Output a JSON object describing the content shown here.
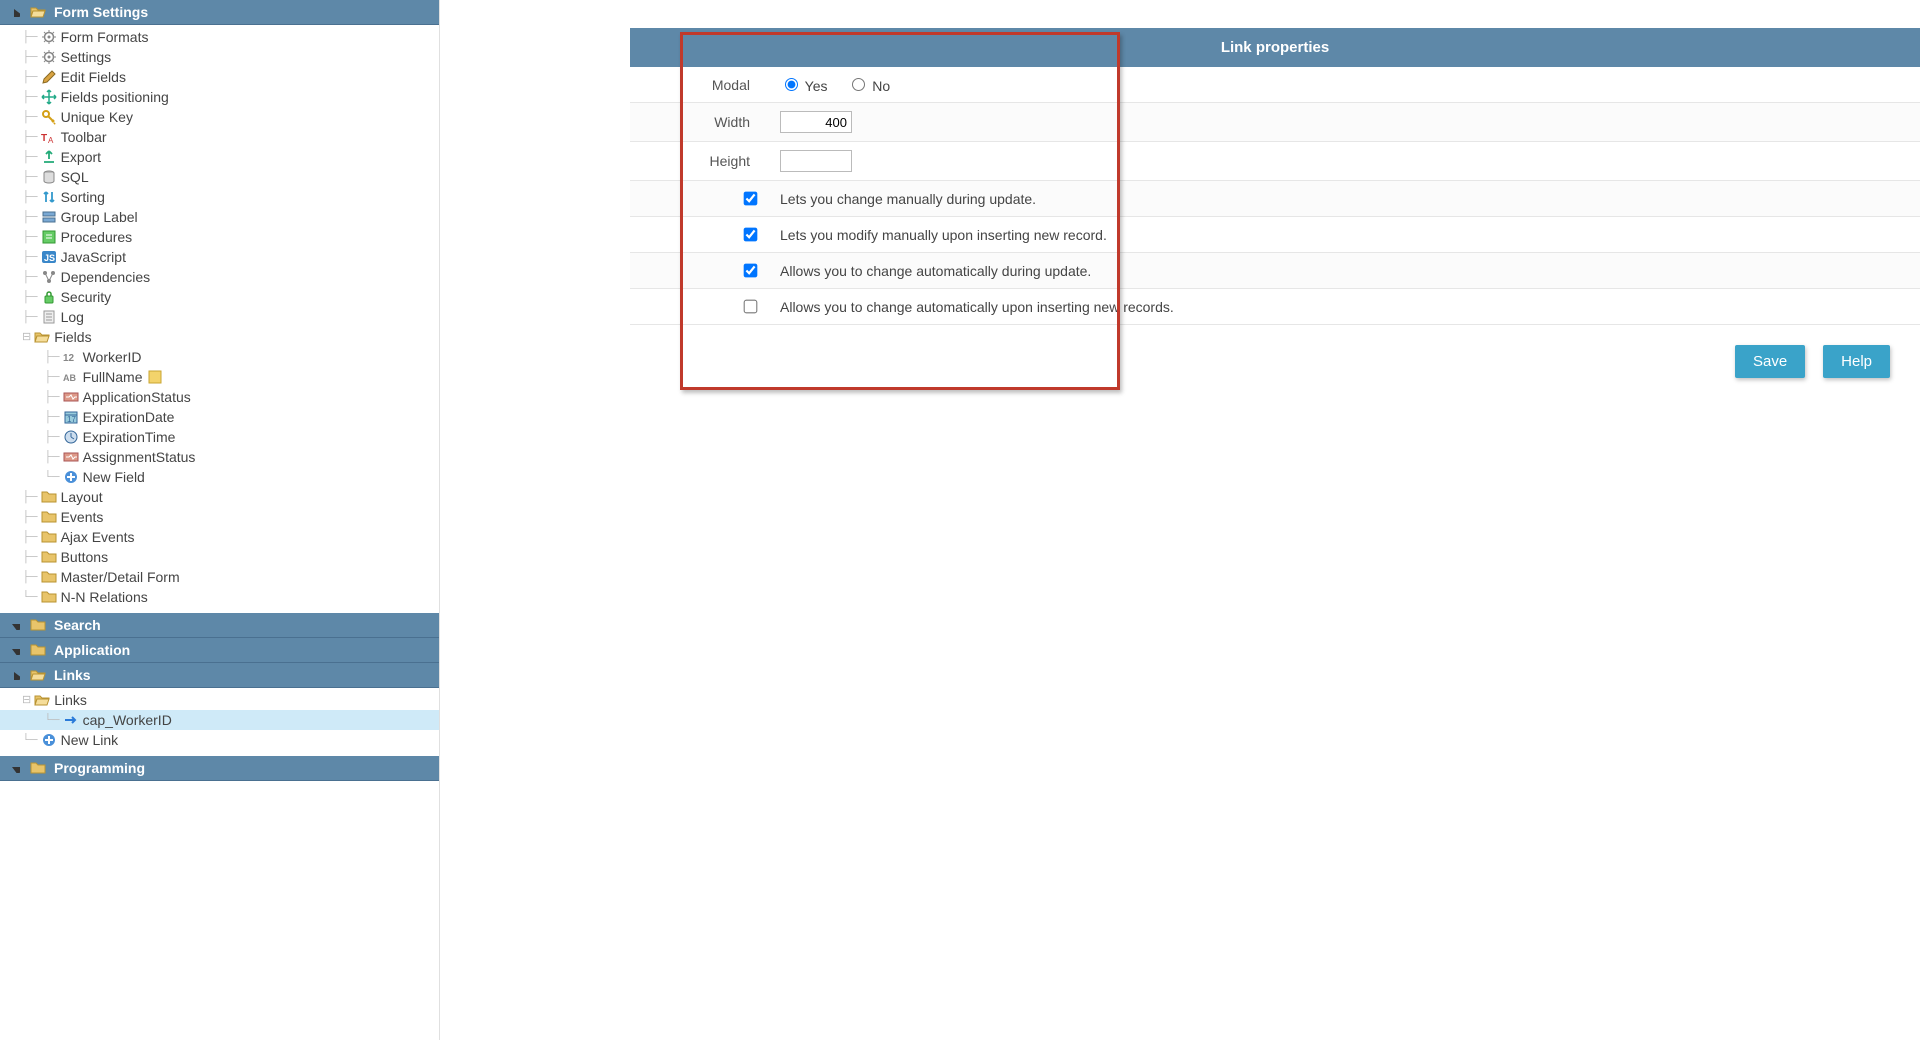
{
  "sidebar": {
    "sections": {
      "form_settings": {
        "title": "Form Settings"
      },
      "search": {
        "title": "Search"
      },
      "application": {
        "title": "Application"
      },
      "links": {
        "title": "Links"
      },
      "programming": {
        "title": "Programming"
      }
    },
    "form_items": [
      {
        "label": "Form Formats",
        "icon": "gear"
      },
      {
        "label": "Settings",
        "icon": "gear"
      },
      {
        "label": "Edit Fields",
        "icon": "pencil"
      },
      {
        "label": "Fields positioning",
        "icon": "move"
      },
      {
        "label": "Unique Key",
        "icon": "key"
      },
      {
        "label": "Toolbar",
        "icon": "toolbar"
      },
      {
        "label": "Export",
        "icon": "export"
      },
      {
        "label": "SQL",
        "icon": "db"
      },
      {
        "label": "Sorting",
        "icon": "sort"
      },
      {
        "label": "Group Label",
        "icon": "group"
      },
      {
        "label": "Procedures",
        "icon": "proc"
      },
      {
        "label": "JavaScript",
        "icon": "js"
      },
      {
        "label": "Dependencies",
        "icon": "dep"
      },
      {
        "label": "Security",
        "icon": "lock"
      },
      {
        "label": "Log",
        "icon": "log"
      }
    ],
    "fields_parent": {
      "label": "Fields"
    },
    "fields": [
      {
        "label": "WorkerID",
        "icon": "num"
      },
      {
        "label": "FullName",
        "icon": "text",
        "flag": true
      },
      {
        "label": "ApplicationStatus",
        "icon": "status"
      },
      {
        "label": "ExpirationDate",
        "icon": "date"
      },
      {
        "label": "ExpirationTime",
        "icon": "time"
      },
      {
        "label": "AssignmentStatus",
        "icon": "status"
      },
      {
        "label": "New Field",
        "icon": "plus"
      }
    ],
    "after_fields": [
      {
        "label": "Layout",
        "icon": "folder"
      },
      {
        "label": "Events",
        "icon": "folder"
      },
      {
        "label": "Ajax Events",
        "icon": "folder"
      },
      {
        "label": "Buttons",
        "icon": "folder"
      },
      {
        "label": "Master/Detail Form",
        "icon": "folder"
      },
      {
        "label": "N-N Relations",
        "icon": "folder"
      }
    ],
    "links_tree": {
      "root": {
        "label": "Links"
      },
      "child": {
        "label": "cap_WorkerID"
      },
      "new": {
        "label": "New Link"
      }
    }
  },
  "panel": {
    "title": "Link properties",
    "rows": {
      "modal_label": "Modal",
      "modal_yes": "Yes",
      "modal_no": "No",
      "width_label": "Width",
      "width_value": "400",
      "height_label": "Height",
      "height_value": "",
      "cb1": "Lets you change manually during update.",
      "cb2": "Lets you modify manually upon inserting new record.",
      "cb3": "Allows you to change automatically during update.",
      "cb4": "Allows you to change automatically upon inserting new records."
    }
  },
  "buttons": {
    "save": "Save",
    "help": "Help"
  }
}
